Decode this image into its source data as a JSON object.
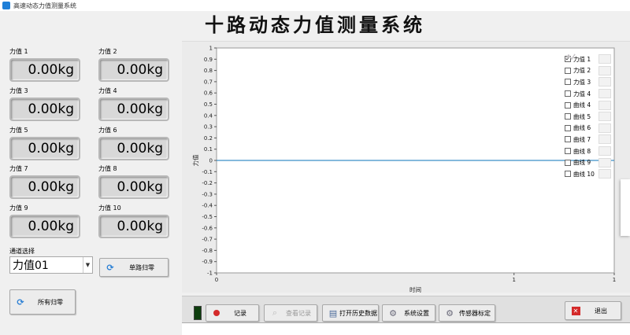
{
  "window": {
    "title": "高速动态力值测量系统"
  },
  "header": {
    "title": "十路动态力值测量系统"
  },
  "gauges": [
    {
      "label": "力值 1",
      "value": "0.00kg"
    },
    {
      "label": "力值 2",
      "value": "0.00kg"
    },
    {
      "label": "力值 3",
      "value": "0.00kg"
    },
    {
      "label": "力值 4",
      "value": "0.00kg"
    },
    {
      "label": "力值 5",
      "value": "0.00kg"
    },
    {
      "label": "力值 6",
      "value": "0.00kg"
    },
    {
      "label": "力值 7",
      "value": "0.00kg"
    },
    {
      "label": "力值 8",
      "value": "0.00kg"
    },
    {
      "label": "力值 9",
      "value": "0.00kg"
    },
    {
      "label": "力值 10",
      "value": "0.00kg"
    }
  ],
  "channel": {
    "label": "通道选择",
    "selected": "力值01"
  },
  "buttons": {
    "single_zero": "单路归零",
    "all_zero": "所有归零"
  },
  "chart_data": {
    "type": "line",
    "xlabel": "时间",
    "ylabel": "力值",
    "xlim": [
      0,
      1
    ],
    "ylim": [
      -1,
      1
    ],
    "xticks": [
      "0",
      "1",
      "1"
    ],
    "yticks": [
      "1",
      "0.9",
      "0.8",
      "0.7",
      "0.6",
      "0.5",
      "0.4",
      "0.3",
      "0.2",
      "0.1",
      "0",
      "-0.1",
      "-0.2",
      "-0.3",
      "-0.4",
      "-0.5",
      "-0.6",
      "-0.7",
      "-0.8",
      "-0.9",
      "-1"
    ],
    "series": [
      {
        "name": "力值 1",
        "x": [
          0,
          1
        ],
        "y": [
          0,
          0
        ],
        "color": "#3a8fc8"
      }
    ],
    "legend": [
      {
        "name": "力值 1",
        "checked": true,
        "color": "#6b9bd1"
      },
      {
        "name": "力值 2",
        "checked": false,
        "color": "#e8a0a8"
      },
      {
        "name": "力值 3",
        "checked": false,
        "color": "#8ccf8c"
      },
      {
        "name": "力值 4",
        "checked": false,
        "color": "#8fb8e0"
      },
      {
        "name": "曲线 4",
        "checked": false,
        "color": "#c8c8c8"
      },
      {
        "name": "曲线 5",
        "checked": false,
        "color": "#b0a0e0"
      },
      {
        "name": "曲线 6",
        "checked": false,
        "color": "#d8c8a0"
      },
      {
        "name": "曲线 7",
        "checked": false,
        "color": "#7aa8e0"
      },
      {
        "name": "曲线 8",
        "checked": false,
        "color": "#e0909c"
      },
      {
        "name": "曲线 9",
        "checked": false,
        "color": "#c8c8c8"
      },
      {
        "name": "曲线 10",
        "checked": false,
        "color": "#c8c8c8"
      }
    ],
    "legend_position": "top-right",
    "grid": false
  },
  "toolbar": {
    "record": "记录",
    "view_record": "查看记录",
    "open_history": "打开历史数据",
    "system_settings": "系统设置",
    "sensor_calibration": "传感器标定",
    "exit": "退出"
  }
}
